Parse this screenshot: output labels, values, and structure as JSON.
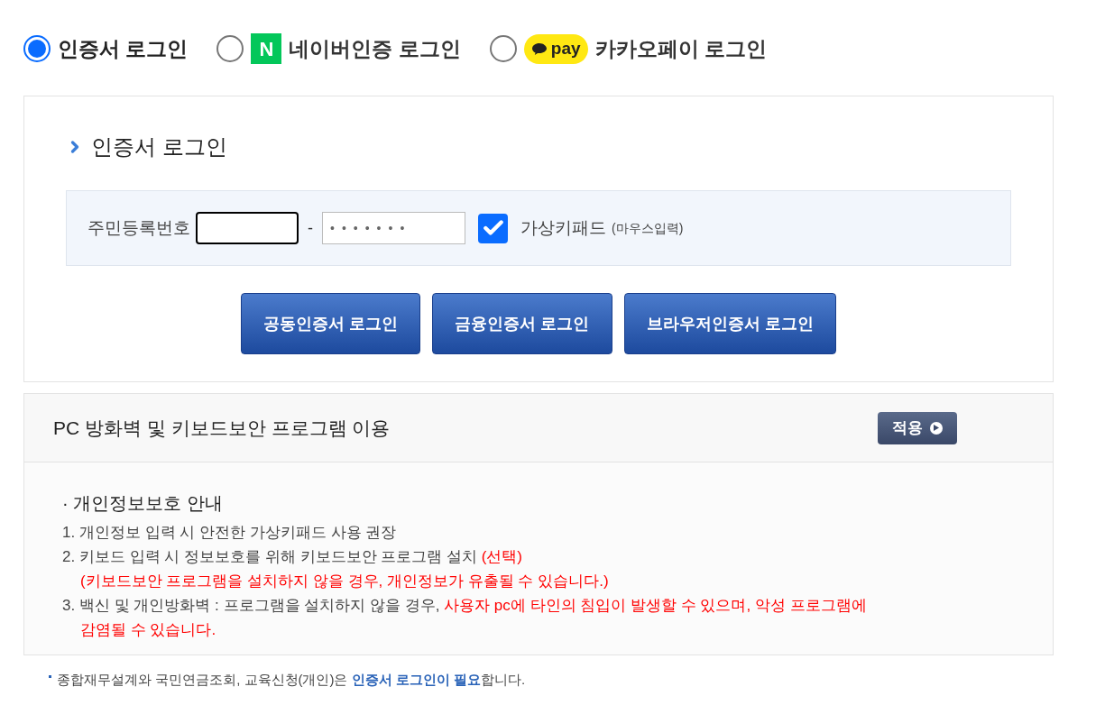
{
  "login_methods": [
    {
      "kind": "certificate",
      "label": "인증서 로그인",
      "selected": true
    },
    {
      "kind": "naver",
      "badge": "N",
      "label": "네이버인증 로그인",
      "selected": false
    },
    {
      "kind": "kakao",
      "badge": "pay",
      "label": "카카오페이 로그인",
      "selected": false
    }
  ],
  "section_title": "인증서 로그인",
  "resident_number": {
    "label": "주민등록번호",
    "separator": "-",
    "second_value": "•••••••",
    "virtual_keypad": {
      "checked": true,
      "label": "가상키패드",
      "hint": "(마우스입력)"
    }
  },
  "login_buttons": [
    "공동인증서 로그인",
    "금융인증서 로그인",
    "브라우저인증서 로그인"
  ],
  "security": {
    "title": "PC 방화벽 및 키보드보안 프로그램 이용",
    "apply_button": "적용",
    "notice_title": "· 개인정보보호 안내",
    "notices": [
      {
        "indent": false,
        "segments": [
          {
            "text": "1. 개인정보 입력 시 안전한 가상키패드 사용 권장",
            "warn": false
          }
        ]
      },
      {
        "indent": false,
        "segments": [
          {
            "text": "2. 키보드 입력 시 정보보호를 위해 키보드보안 프로그램 설치 ",
            "warn": false
          },
          {
            "text": "(선택)",
            "warn": true
          }
        ]
      },
      {
        "indent": true,
        "segments": [
          {
            "text": "(키보드보안 프로그램을 설치하지 않을 경우, 개인정보가 유출될 수 있습니다.)",
            "warn": true
          }
        ]
      },
      {
        "indent": false,
        "segments": [
          {
            "text": "3. 백신 및 개인방화벽 : 프로그램을 설치하지 않을 경우, ",
            "warn": false
          },
          {
            "text": "사용자 pc에 타인의 침입이 발생할 수 있으며, 악성 프로그램에 감염될 수 있습니다.",
            "warn": true
          }
        ]
      }
    ]
  },
  "footer_note": [
    {
      "text": "종합재무설계와 국민연금조회, 교육신청(개인)은 ",
      "highlight": false
    },
    {
      "text": "인증서 로그인이 필요",
      "highlight": true
    },
    {
      "text": "합니다.",
      "highlight": false
    }
  ]
}
